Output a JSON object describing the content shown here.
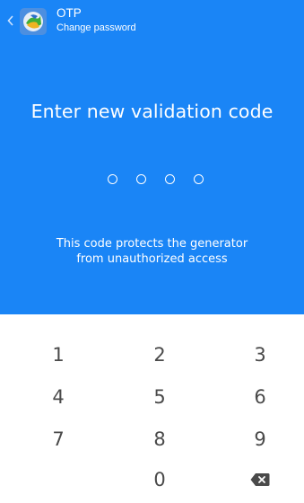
{
  "header": {
    "title": "OTP",
    "subtitle": "Change password",
    "back_icon": "chevron-left-icon",
    "logo_icon": "metatrader-logo-icon"
  },
  "hero": {
    "heading": "Enter new validation code",
    "note_line1": "This code protects the generator",
    "note_line2": "from unauthorized access",
    "entered_digits": 0,
    "code_length": 4
  },
  "keypad": {
    "keys": [
      "1",
      "2",
      "3",
      "4",
      "5",
      "6",
      "7",
      "8",
      "9",
      "0"
    ],
    "backspace_icon": "backspace-icon"
  },
  "colors": {
    "primary": "#1a85f6",
    "key_text": "#4a4a4a",
    "background": "#ffffff"
  }
}
